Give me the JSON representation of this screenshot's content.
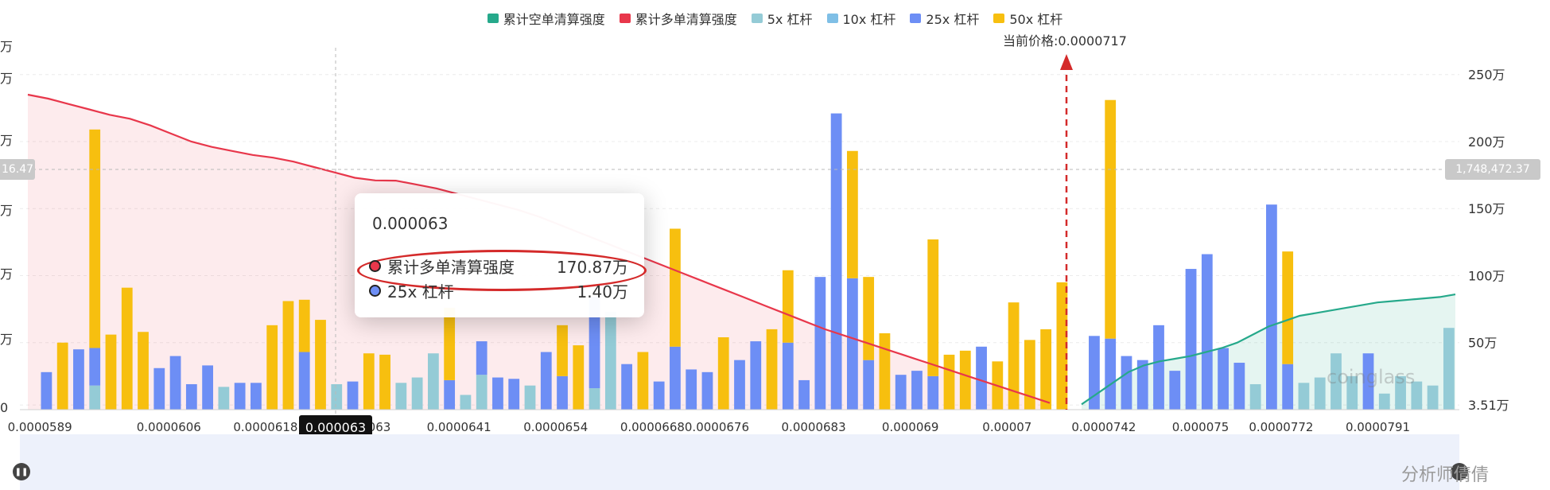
{
  "legend": [
    {
      "label": "累计空单清算强度",
      "color": "#26a98b"
    },
    {
      "label": "累计多单清算强度",
      "color": "#e8374b"
    },
    {
      "label": "5x 杠杆",
      "color": "#94cbd6"
    },
    {
      "label": "10x 杠杆",
      "color": "#7fbfe6"
    },
    {
      "label": "25x 杠杆",
      "color": "#6d8ef5"
    },
    {
      "label": "50x 杠杆",
      "color": "#f7bf0f"
    }
  ],
  "current_price_label": "当前价格:0.0000717",
  "crosshair_label": "0.000063",
  "right_badge": "1,748,472.37",
  "left_badge": "16.47",
  "left_axis_fragments": [
    "万",
    "万",
    "万",
    "万",
    "万",
    "万",
    "0"
  ],
  "tooltip": {
    "title": "0.000063",
    "rows": [
      {
        "label": "累计多单清算强度",
        "value": "170.87万",
        "dot_color": "#e8374b"
      },
      {
        "label": "25x 杠杆",
        "value": "1.40万",
        "dot_color": "#6d8ef5"
      }
    ]
  },
  "watermark": "coinglass",
  "credit": "分析师倩倩",
  "slider_handle_icon": "pause-icon",
  "chart_data": {
    "type": "bar",
    "x_axis_labels": [
      "0.0000589",
      "0.0000606",
      "0.0000618",
      "0.000063",
      "0.0000641",
      "0.0000654",
      "0.0000668",
      "0.0000676",
      "0.0000683",
      "0.000069",
      "0.00007",
      "0.0000742",
      "0.000075",
      "0.0000772",
      "0.0000791"
    ],
    "right_axis": {
      "ticks": [
        "250万",
        "200万",
        "150万",
        "100万",
        "50万",
        "3.51万"
      ],
      "values": [
        250,
        200,
        150,
        100,
        50,
        3.51
      ],
      "unit": "万",
      "ylim": [
        0,
        270
      ]
    },
    "current_price": 7.17e-05,
    "bars": [
      {
        "x": "0.0000589",
        "blue": 0,
        "yellow": 0,
        "lightblue": 0
      },
      {
        "x": "",
        "blue": 28,
        "yellow": 0,
        "lightblue": 0
      },
      {
        "x": "",
        "blue": 0,
        "yellow": 50,
        "lightblue": 0
      },
      {
        "x": "",
        "blue": 45,
        "yellow": 0,
        "lightblue": 0
      },
      {
        "x": "",
        "blue": 28,
        "yellow": 163,
        "lightblue": 18
      },
      {
        "x": "",
        "blue": 0,
        "yellow": 56,
        "lightblue": 0
      },
      {
        "x": "",
        "blue": 0,
        "yellow": 91,
        "lightblue": 0
      },
      {
        "x": "",
        "blue": 0,
        "yellow": 58,
        "lightblue": 0
      },
      {
        "x": "0.0000606",
        "blue": 31,
        "yellow": 0,
        "lightblue": 0
      },
      {
        "x": "",
        "blue": 40,
        "yellow": 0,
        "lightblue": 0
      },
      {
        "x": "",
        "blue": 19,
        "yellow": 0,
        "lightblue": 0
      },
      {
        "x": "",
        "blue": 33,
        "yellow": 0,
        "lightblue": 0
      },
      {
        "x": "",
        "blue": 0,
        "yellow": 0,
        "lightblue": 17
      },
      {
        "x": "",
        "blue": 20,
        "yellow": 0,
        "lightblue": 0
      },
      {
        "x": "0.0000618",
        "blue": 20,
        "yellow": 0,
        "lightblue": 0
      },
      {
        "x": "",
        "blue": 0,
        "yellow": 63,
        "lightblue": 0
      },
      {
        "x": "",
        "blue": 0,
        "yellow": 81,
        "lightblue": 0
      },
      {
        "x": "",
        "blue": 43,
        "yellow": 39,
        "lightblue": 0
      },
      {
        "x": "",
        "blue": 0,
        "yellow": 67,
        "lightblue": 0
      },
      {
        "x": "",
        "blue": 0,
        "yellow": 0,
        "lightblue": 19
      },
      {
        "x": "0.000063",
        "blue": 21,
        "yellow": 0,
        "lightblue": 0
      },
      {
        "x": "",
        "blue": 0,
        "yellow": 42,
        "lightblue": 0
      },
      {
        "x": "",
        "blue": 0,
        "yellow": 41,
        "lightblue": 0
      },
      {
        "x": "",
        "blue": 0,
        "yellow": 0,
        "lightblue": 20
      },
      {
        "x": "",
        "blue": 0,
        "yellow": 0,
        "lightblue": 24
      },
      {
        "x": "",
        "blue": 0,
        "yellow": 0,
        "lightblue": 42
      },
      {
        "x": "0.0000641",
        "blue": 22,
        "yellow": 54,
        "lightblue": 0
      },
      {
        "x": "",
        "blue": 0,
        "yellow": 0,
        "lightblue": 11
      },
      {
        "x": "",
        "blue": 25,
        "yellow": 0,
        "lightblue": 26
      },
      {
        "x": "",
        "blue": 24,
        "yellow": 0,
        "lightblue": 0
      },
      {
        "x": "",
        "blue": 23,
        "yellow": 0,
        "lightblue": 0
      },
      {
        "x": "",
        "blue": 0,
        "yellow": 0,
        "lightblue": 18
      },
      {
        "x": "0.0000654",
        "blue": 43,
        "yellow": 0,
        "lightblue": 0
      },
      {
        "x": "",
        "blue": 25,
        "yellow": 38,
        "lightblue": 0
      },
      {
        "x": "",
        "blue": 0,
        "yellow": 48,
        "lightblue": 0
      },
      {
        "x": "",
        "blue": 68,
        "yellow": 0,
        "lightblue": 16
      },
      {
        "x": "",
        "blue": 0,
        "yellow": 0,
        "lightblue": 73
      },
      {
        "x": "",
        "blue": 34,
        "yellow": 0,
        "lightblue": 0
      },
      {
        "x": "0.0000668",
        "blue": 0,
        "yellow": 43,
        "lightblue": 0
      },
      {
        "x": "",
        "blue": 21,
        "yellow": 0,
        "lightblue": 0
      },
      {
        "x": "",
        "blue": 47,
        "yellow": 88,
        "lightblue": 0
      },
      {
        "x": "",
        "blue": 30,
        "yellow": 0,
        "lightblue": 0
      },
      {
        "x": "0.0000676",
        "blue": 28,
        "yellow": 0,
        "lightblue": 0
      },
      {
        "x": "",
        "blue": 0,
        "yellow": 54,
        "lightblue": 0
      },
      {
        "x": "",
        "blue": 37,
        "yellow": 0,
        "lightblue": 0
      },
      {
        "x": "",
        "blue": 51,
        "yellow": 0,
        "lightblue": 0
      },
      {
        "x": "",
        "blue": 0,
        "yellow": 60,
        "lightblue": 0
      },
      {
        "x": "",
        "blue": 50,
        "yellow": 54,
        "lightblue": 0
      },
      {
        "x": "0.0000683",
        "blue": 22,
        "yellow": 0,
        "lightblue": 0
      },
      {
        "x": "",
        "blue": 99,
        "yellow": 0,
        "lightblue": 0
      },
      {
        "x": "",
        "blue": 221,
        "yellow": 0,
        "lightblue": 0
      },
      {
        "x": "",
        "blue": 98,
        "yellow": 95,
        "lightblue": 0
      },
      {
        "x": "",
        "blue": 37,
        "yellow": 62,
        "lightblue": 0
      },
      {
        "x": "",
        "blue": 0,
        "yellow": 57,
        "lightblue": 0
      },
      {
        "x": "0.000069",
        "blue": 26,
        "yellow": 0,
        "lightblue": 0
      },
      {
        "x": "",
        "blue": 29,
        "yellow": 0,
        "lightblue": 0
      },
      {
        "x": "",
        "blue": 25,
        "yellow": 102,
        "lightblue": 0
      },
      {
        "x": "",
        "blue": 0,
        "yellow": 41,
        "lightblue": 0
      },
      {
        "x": "",
        "blue": 0,
        "yellow": 44,
        "lightblue": 0
      },
      {
        "x": "",
        "blue": 47,
        "yellow": 0,
        "lightblue": 0
      },
      {
        "x": "0.00007",
        "blue": 0,
        "yellow": 36,
        "lightblue": 0
      },
      {
        "x": "",
        "blue": 0,
        "yellow": 80,
        "lightblue": 0
      },
      {
        "x": "",
        "blue": 0,
        "yellow": 52,
        "lightblue": 0
      },
      {
        "x": "",
        "blue": 0,
        "yellow": 60,
        "lightblue": 0
      },
      {
        "x": "",
        "blue": 0,
        "yellow": 95,
        "lightblue": 0
      },
      {
        "x": "",
        "blue": 0,
        "yellow": 0,
        "lightblue": 0
      },
      {
        "x": "0.0000742",
        "blue": 55,
        "yellow": 0,
        "lightblue": 0
      },
      {
        "x": "",
        "blue": 53,
        "yellow": 178,
        "lightblue": 0
      },
      {
        "x": "",
        "blue": 40,
        "yellow": 0,
        "lightblue": 0
      },
      {
        "x": "",
        "blue": 37,
        "yellow": 0,
        "lightblue": 0
      },
      {
        "x": "",
        "blue": 63,
        "yellow": 0,
        "lightblue": 0
      },
      {
        "x": "",
        "blue": 29,
        "yellow": 0,
        "lightblue": 0
      },
      {
        "x": "0.000075",
        "blue": 105,
        "yellow": 0,
        "lightblue": 0
      },
      {
        "x": "",
        "blue": 116,
        "yellow": 0,
        "lightblue": 0
      },
      {
        "x": "",
        "blue": 46,
        "yellow": 0,
        "lightblue": 0
      },
      {
        "x": "",
        "blue": 35,
        "yellow": 0,
        "lightblue": 0
      },
      {
        "x": "",
        "blue": 0,
        "yellow": 0,
        "lightblue": 19
      },
      {
        "x": "0.0000772",
        "blue": 153,
        "yellow": 0,
        "lightblue": 0
      },
      {
        "x": "",
        "blue": 34,
        "yellow": 84,
        "lightblue": 0
      },
      {
        "x": "",
        "blue": 0,
        "yellow": 0,
        "lightblue": 20
      },
      {
        "x": "",
        "blue": 0,
        "yellow": 0,
        "lightblue": 24
      },
      {
        "x": "",
        "blue": 0,
        "yellow": 0,
        "lightblue": 42
      },
      {
        "x": "",
        "blue": 0,
        "yellow": 0,
        "lightblue": 25
      },
      {
        "x": "0.0000791",
        "blue": 42,
        "yellow": 0,
        "lightblue": 0
      },
      {
        "x": "",
        "blue": 0,
        "yellow": 0,
        "lightblue": 12
      },
      {
        "x": "",
        "blue": 0,
        "yellow": 0,
        "lightblue": 25
      },
      {
        "x": "",
        "blue": 0,
        "yellow": 0,
        "lightblue": 21
      },
      {
        "x": "",
        "blue": 0,
        "yellow": 0,
        "lightblue": 18
      },
      {
        "x": "",
        "blue": 0,
        "yellow": 0,
        "lightblue": 61
      }
    ],
    "long_curve": [
      235,
      232,
      228,
      224,
      220,
      217,
      212,
      206,
      200,
      196,
      193,
      190,
      188,
      185,
      181,
      177,
      173,
      171,
      170.87,
      168,
      165,
      161,
      157,
      153,
      149,
      144,
      138,
      132,
      126,
      120,
      114,
      108,
      102,
      96,
      90,
      84,
      78,
      72,
      66,
      60,
      55,
      50,
      45,
      40,
      35,
      30,
      25,
      20,
      15,
      10,
      5
    ],
    "short_curve": [
      4,
      12,
      20,
      28,
      33,
      36,
      38,
      40,
      43,
      46,
      50,
      56,
      62,
      66,
      70,
      72,
      74,
      76,
      78,
      80,
      81,
      82,
      83,
      84,
      86
    ]
  }
}
